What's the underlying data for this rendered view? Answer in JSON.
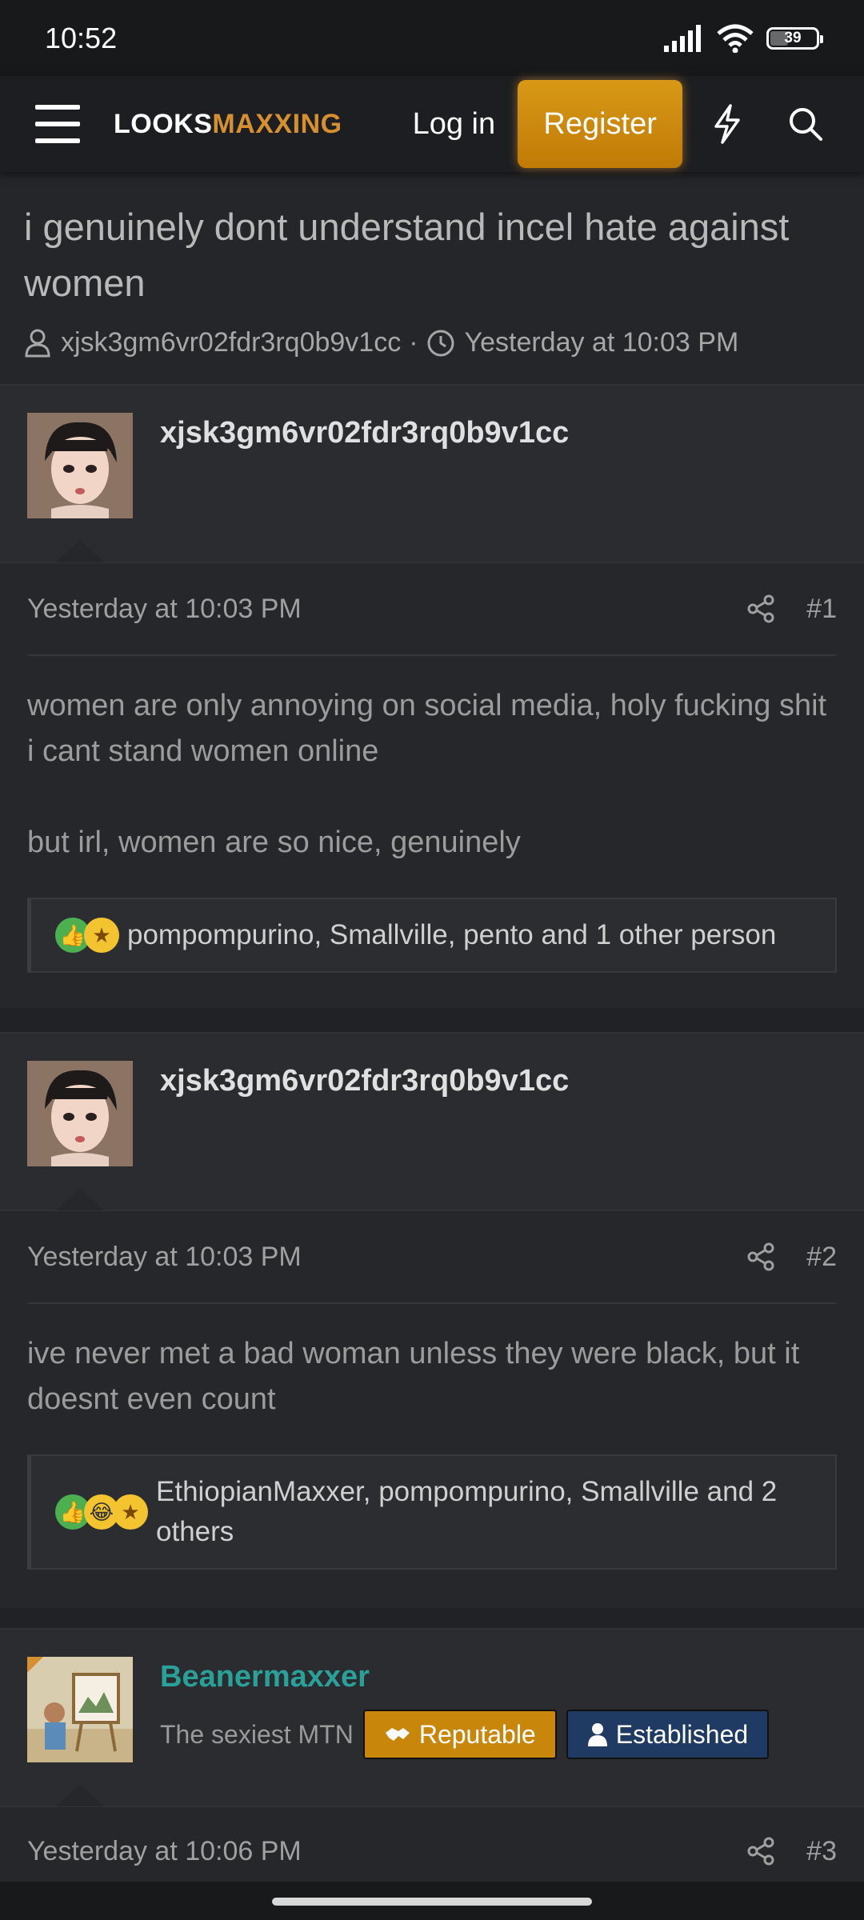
{
  "status_bar": {
    "time": "10:52",
    "battery": "39"
  },
  "header": {
    "logo_part1": "LOOKS",
    "logo_part2": "MAXXING",
    "login_label": "Log in",
    "register_label": "Register",
    "accent_color": "#d6902f"
  },
  "thread": {
    "title": "i genuinely dont understand incel hate against women",
    "author": "xjsk3gm6vr02fdr3rq0b9v1cc",
    "separator": "·",
    "time": "Yesterday at 10:03 PM"
  },
  "posts": [
    {
      "username": "xjsk3gm6vr02fdr3rq0b9v1cc",
      "time": "Yesterday at 10:03 PM",
      "number": "#1",
      "paragraphs": [
        "women are only annoying on social media, holy fucking shit i cant stand women online",
        "but irl, women are so nice, genuinely"
      ],
      "reactions": "pompompurino, Smallville, pento and 1 other person"
    },
    {
      "username": "xjsk3gm6vr02fdr3rq0b9v1cc",
      "time": "Yesterday at 10:03 PM",
      "number": "#2",
      "paragraphs": [
        "ive never met a bad woman unless they were black, but it doesnt even count"
      ],
      "reactions": "EthiopianMaxxer, pompompurino, Smallville and 2 others"
    },
    {
      "username": "Beanermaxxer",
      "user_title": "The sexiest MTN",
      "badges": [
        "Reputable",
        "Established"
      ],
      "time": "Yesterday at 10:06 PM",
      "number": "#3"
    }
  ]
}
